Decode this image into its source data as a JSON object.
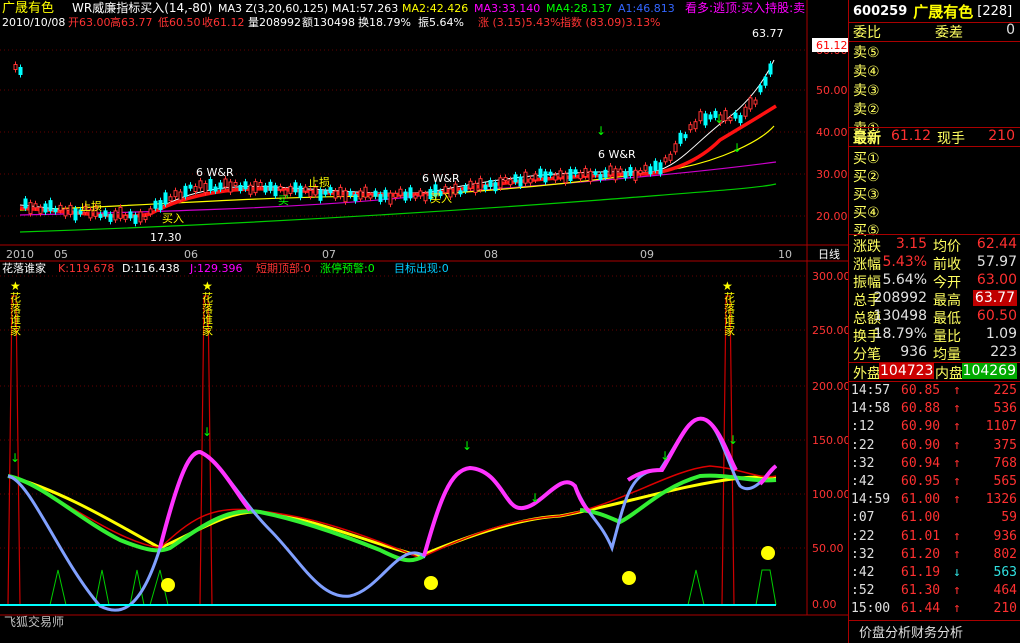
{
  "top": {
    "stock_name": "广晟有色",
    "indicator_name": "WR威廉指标买入(14,-80)",
    "ma_label": "MA3 Z(3,20,60,125)",
    "ma1": "MA1:57.263",
    "ma2": "MA2:42.426",
    "ma3": "MA3:33.140",
    "ma4": "MA4:28.137",
    "a1": "A1:46.813",
    "signal": "看多:逃顶:买入持股:卖",
    "date": "2010/10/08",
    "open": "开63.00",
    "high": "高63.77",
    "low": "低60.50",
    "close": "收61.12",
    "vol": "量208992",
    "amount": "额130498",
    "turnover": "换18.79%",
    "amplitude": "振5.64%",
    "change": "涨 (3.15)5.43%",
    "index": "指数 (83.09)3.13%"
  },
  "price_axis": {
    "labels": [
      "60.00",
      "50.00",
      "40.00",
      "30.00",
      "20.00"
    ],
    "current": "61.12",
    "max_label": "63.77",
    "min_label": "17.30"
  },
  "time_axis": {
    "labels": [
      "2010",
      "05",
      "06",
      "07",
      "08",
      "09",
      "10"
    ],
    "period": "日线"
  },
  "annotations": {
    "stop_loss": "止损",
    "buy_in": "买入",
    "w_buy": "6 W&R",
    "buy": "买"
  },
  "osc": {
    "name": "花落谁家",
    "k": "K:119.678",
    "d": "D:116.438",
    "j": "J:129.396",
    "top": "短期顶部:0",
    "warn": "涨停预警:0",
    "target": "目标出现:0",
    "star_label": "花落谁家",
    "axis": [
      "300.00",
      "250.00",
      "200.00",
      "150.00",
      "100.00",
      "50.00",
      "0.00"
    ],
    "footer": "飞狐交易师"
  },
  "side": {
    "code": "600259",
    "name": "广晟有色",
    "count": "[228]",
    "weibi_label": "委比",
    "weicha_label": "委差",
    "weicha_value": "0",
    "sell": [
      "卖⑤",
      "卖④",
      "卖③",
      "卖②",
      "卖①"
    ],
    "latest_label": "最新",
    "latest_value": "61.12",
    "xianshou_label": "现手",
    "xianshou_value": "210",
    "buy": [
      "买①",
      "买②",
      "买③",
      "买④",
      "买⑤"
    ],
    "stats": [
      {
        "l1": "涨跌",
        "v1": "3.15",
        "l2": "均价",
        "v2": "62.44",
        "c1": "r",
        "c2": "r"
      },
      {
        "l1": "涨幅",
        "v1": "5.43%",
        "l2": "前收",
        "v2": "57.97",
        "c1": "r",
        "c2": "w"
      },
      {
        "l1": "振幅",
        "v1": "5.64%",
        "l2": "今开",
        "v2": "63.00",
        "c1": "w",
        "c2": "r"
      },
      {
        "l1": "总手",
        "v1": "208992",
        "l2": "最高",
        "v2": "63.77",
        "c1": "w",
        "c2": "box"
      },
      {
        "l1": "总额",
        "v1": "130498",
        "l2": "最低",
        "v2": "60.50",
        "c1": "w",
        "c2": "r"
      },
      {
        "l1": "换手",
        "v1": "18.79%",
        "l2": "量比",
        "v2": "1.09",
        "c1": "w",
        "c2": "w"
      },
      {
        "l1": "分笔",
        "v1": "936",
        "l2": "均量",
        "v2": "223",
        "c1": "w",
        "c2": "w"
      }
    ],
    "waipan_label": "外盘",
    "waipan_value": "104723",
    "neipan_label": "内盘",
    "neipan_value": "104269",
    "ticks": [
      {
        "t": "14:57",
        "p": "60.85",
        "a": "↑",
        "v": "225",
        "tc": "w",
        "ac": "r",
        "vc": "r"
      },
      {
        "t": "14:58",
        "p": "60.88",
        "a": "↑",
        "v": "536",
        "tc": "w",
        "ac": "r",
        "vc": "r"
      },
      {
        "t": ":12",
        "p": "60.90",
        "a": "↑",
        "v": "1107",
        "tc": "w",
        "ac": "r",
        "vc": "r"
      },
      {
        "t": ":22",
        "p": "60.90",
        "a": "↑",
        "v": "375",
        "tc": "w",
        "ac": "r",
        "vc": "r"
      },
      {
        "t": ":32",
        "p": "60.94",
        "a": "↑",
        "v": "768",
        "tc": "w",
        "ac": "r",
        "vc": "r"
      },
      {
        "t": ":42",
        "p": "60.95",
        "a": "↑",
        "v": "565",
        "tc": "w",
        "ac": "r",
        "vc": "r"
      },
      {
        "t": "14:59",
        "p": "61.00",
        "a": "↑",
        "v": "1326",
        "tc": "w",
        "ac": "r",
        "vc": "r"
      },
      {
        "t": ":07",
        "p": "61.00",
        "a": "",
        "v": "59",
        "tc": "w",
        "ac": "r",
        "vc": "r"
      },
      {
        "t": ":22",
        "p": "61.01",
        "a": "↑",
        "v": "936",
        "tc": "w",
        "ac": "r",
        "vc": "r"
      },
      {
        "t": ":32",
        "p": "61.20",
        "a": "↑",
        "v": "802",
        "tc": "w",
        "ac": "r",
        "vc": "r"
      },
      {
        "t": ":42",
        "p": "61.19",
        "a": "↓",
        "v": "563",
        "tc": "w",
        "ac": "c",
        "vc": "c"
      },
      {
        "t": ":52",
        "p": "61.30",
        "a": "↑",
        "v": "464",
        "tc": "w",
        "ac": "r",
        "vc": "r"
      },
      {
        "t": "15:00",
        "p": "61.44",
        "a": "↑",
        "v": "210",
        "tc": "w",
        "ac": "r",
        "vc": "r"
      }
    ],
    "footer": "价盘分析财务分析"
  }
}
